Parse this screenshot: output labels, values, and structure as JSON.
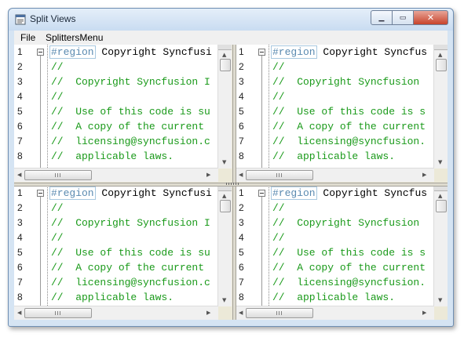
{
  "window": {
    "title": "Split Views"
  },
  "menubar": {
    "items": [
      "File",
      "SplittersMenu"
    ]
  },
  "editor": {
    "line_numbers": [
      "1",
      "2",
      "3",
      "4",
      "5",
      "6",
      "7",
      "8"
    ],
    "panes": [
      {
        "lines": [
          "#region",
          "Copyright Syncfusi",
          "//",
          "//  Copyright Syncfusion I",
          "//",
          "//  Use of this code is su",
          "//  A copy of the current",
          "//  licensing@syncfusion.c",
          "//  applicable laws."
        ]
      },
      {
        "lines": [
          "#region",
          "Copyright Syncfus",
          "//",
          "//  Copyright Syncfusion",
          "//",
          "//  Use of this code is s",
          "//  A copy of the current",
          "//  licensing@syncfusion.",
          "//  applicable laws."
        ]
      },
      {
        "lines": [
          "#region",
          "Copyright Syncfusi",
          "//",
          "//  Copyright Syncfusion I",
          "//",
          "//  Use of this code is su",
          "//  A copy of the current",
          "//  licensing@syncfusion.c",
          "//  applicable laws."
        ]
      },
      {
        "lines": [
          "#region",
          "Copyright Syncfus",
          "//",
          "//  Copyright Syncfusion",
          "//",
          "//  Use of this code is s",
          "//  A copy of the current",
          "//  licensing@syncfusion.",
          "//  applicable laws."
        ]
      }
    ]
  },
  "colors": {
    "comment": "#1a9a1a",
    "region_tag": "#5a8ab0"
  },
  "icons": {
    "minimize": "minimize-icon",
    "maximize": "maximize-icon",
    "close": "close-icon"
  }
}
